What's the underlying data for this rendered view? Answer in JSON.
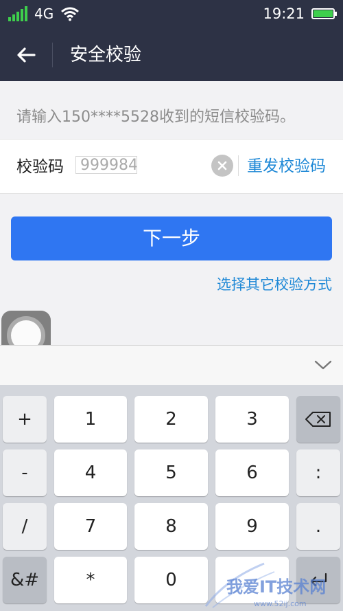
{
  "status_bar": {
    "network": "4G",
    "time": "19:21",
    "colors": {
      "signal": "#3ecf4c",
      "battery": "#3ecf4c"
    },
    "icons": [
      "signal-icon",
      "wifi-icon",
      "battery-icon"
    ]
  },
  "header": {
    "title": "安全校验",
    "back_icon": "arrow-left-icon"
  },
  "hint": "请输入150****5528收到的短信校验码。",
  "code_field": {
    "label": "校验码",
    "value": "999984",
    "clear_icon": "clear-circle-icon",
    "resend_label": "重发校验码"
  },
  "next_button": {
    "label": "下一步",
    "color": "#2f76f2"
  },
  "other_method_link": "选择其它校验方式",
  "keyboard": {
    "collapse_icon": "chevron-down-icon",
    "rows": [
      [
        "+",
        "1",
        "2",
        "3",
        "backspace"
      ],
      [
        "-",
        "4",
        "5",
        "6",
        ":"
      ],
      [
        "/",
        "7",
        "8",
        "9",
        "."
      ],
      [
        "&#",
        "*",
        "0",
        "",
        "enter"
      ]
    ]
  },
  "watermark": {
    "text": "我爱IT技术网",
    "url_text": "www.52ij.com"
  }
}
